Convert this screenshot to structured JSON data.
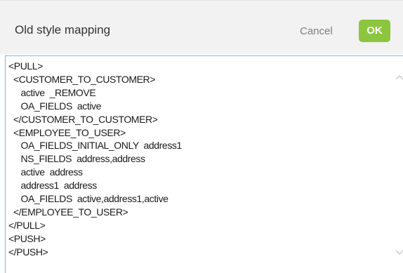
{
  "dialog": {
    "title": "Old style mapping",
    "cancel_label": "Cancel",
    "ok_label": "OK"
  },
  "editor": {
    "content": "<PULL>\n  <CUSTOMER_TO_CUSTOMER>\n     active  _REMOVE\n     OA_FIELDS  active\n  </CUSTOMER_TO_CUSTOMER>\n  <EMPLOYEE_TO_USER>\n     OA_FIELDS_INITIAL_ONLY  address1\n     NS_FIELDS  address,address\n     active  address\n     address1  address\n     OA_FIELDS  active,address1,active\n  </EMPLOYEE_TO_USER>\n</PULL>\n<PUSH>\n</PUSH>"
  },
  "colors": {
    "header_bg": "#f2f2f2",
    "ok_button": "#8cc63e",
    "editor_border": "#7fb3e1"
  },
  "icons": {
    "scroll_up": "chevron-up-icon",
    "scroll_down": "chevron-down-icon"
  }
}
